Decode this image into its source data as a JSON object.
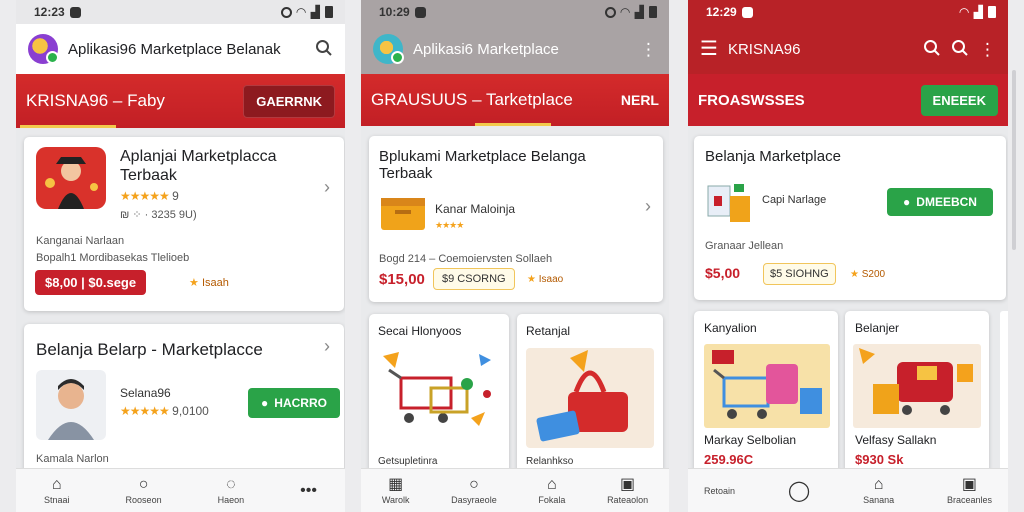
{
  "colors": {
    "brand_red": "#c7202b",
    "green": "#2aa348",
    "star": "#f4a21c"
  },
  "phone1": {
    "status": {
      "time": "12:23"
    },
    "appbar": {
      "title": "Aplikasi96 Marketplace Belanak",
      "search_icon": "search-icon"
    },
    "redbar": {
      "label": "KRISNA96 – Faby",
      "button": "GAERRNK"
    },
    "card1": {
      "title_line1": "Aplanjai Marketplacca",
      "title_line2": "Terbaak",
      "stars": "★★★★★",
      "rating": "9",
      "downloads": "₪ ⁘ · 3235 9U)",
      "sub": "Kanganai Narlaan",
      "desc": "Bopalh1 Mordibasekas Tlelioeb",
      "price": "$8,00 | $0.sege",
      "badge": "Isaah"
    },
    "card2": {
      "title": "Belanja Belarp - Marketplacce",
      "seller": "Selana96",
      "stars": "★★★★★",
      "rating": "9,0100",
      "button": "HACRRO",
      "sub": "Kamala Narlon"
    },
    "nav": [
      "Stnaai",
      "Rooseon",
      "Haeon",
      "•••"
    ]
  },
  "phone2": {
    "status": {
      "time": "10:29"
    },
    "appbar": {
      "title": "Aplikasi6 Marketplace"
    },
    "redbar": {
      "label": "GRAUSUUS – Tarketplace",
      "right": "NERL"
    },
    "card": {
      "title_line1": "Bplukami Marketplace Belanga",
      "title_line2": "Terbaak",
      "item": "Kanar Maloinja",
      "stars": "★★★★",
      "desc": "Bogd 214 – Coemoiervsten Sollaeh",
      "price": "$15,00",
      "pill": "$9 CSORNG",
      "badge": "Isaao"
    },
    "tile1": {
      "title": "Secai Hlonyoos",
      "caption": "Getsupletinra"
    },
    "tile2": {
      "title": "Retanjal",
      "caption": "Relanhkso"
    },
    "nav": [
      "Warolk",
      "Dasyraeole",
      "Fokala",
      "Rateaolon"
    ]
  },
  "phone3": {
    "status": {
      "time": "12:29"
    },
    "appbar": {
      "title": "KRISNA96"
    },
    "redbar": {
      "label": "FROASWSSES",
      "button": "ENEEEK"
    },
    "card": {
      "title": "Belanja Marketplace",
      "item": "Capi Narlage",
      "button": "DMEEBCN",
      "sub": "Granaar Jellean",
      "price": "$5,00",
      "pill": "$5 SIOHNG",
      "badge": "S200"
    },
    "tile1": {
      "title": "Kanyalion",
      "caption1": "Markay Selbolian",
      "caption2": "259.96C"
    },
    "tile2": {
      "title": "Belanjer",
      "caption1": "Velfasy Sallakn",
      "caption2": "$930 Sk"
    },
    "nav": [
      "Retoain",
      "Sanana",
      "Braceanles"
    ]
  }
}
